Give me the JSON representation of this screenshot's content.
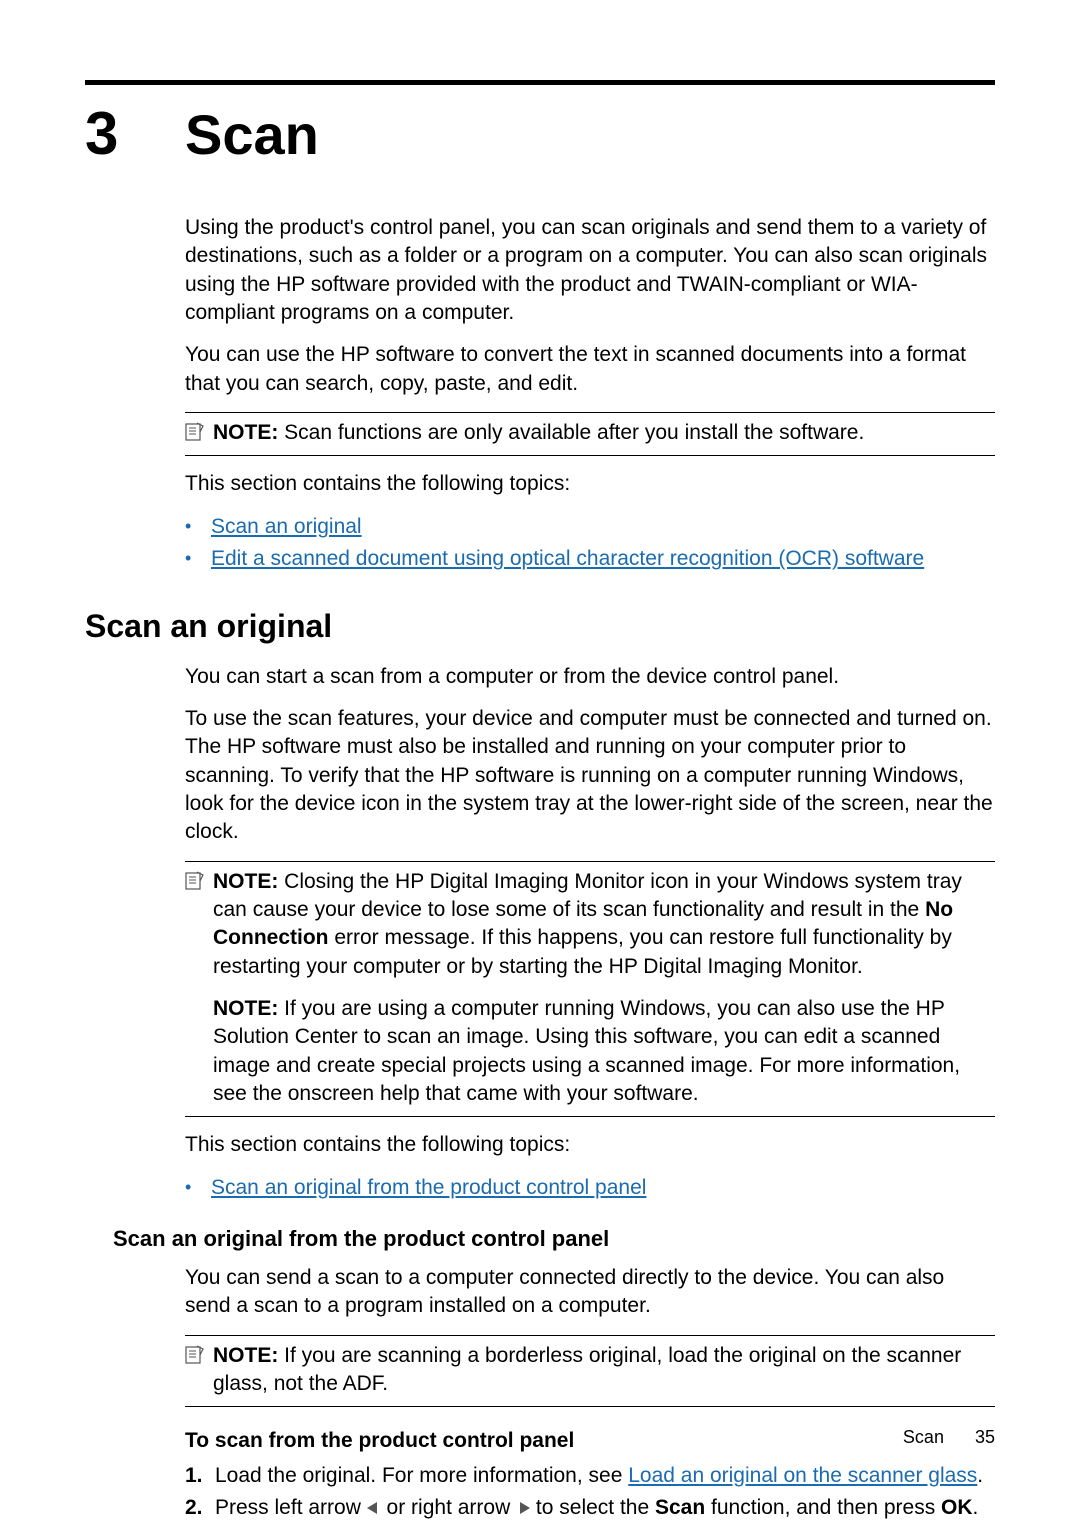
{
  "chapter": {
    "number": "3",
    "title": "Scan"
  },
  "intro_p1": "Using the product's control panel, you can scan originals and send them to a variety of destinations, such as a folder or a program on a computer. You can also scan originals using the HP software provided with the product and TWAIN-compliant or WIA-compliant programs on a computer.",
  "intro_p2": "You can use the HP software to convert the text in scanned documents into a format that you can search, copy, paste, and edit.",
  "note1_label": "NOTE:",
  "note1_text": " Scan functions are only available after you install the software.",
  "topics_lead": "This section contains the following topics:",
  "topics": [
    "Scan an original",
    "Edit a scanned document using optical character recognition (OCR) software"
  ],
  "section1": {
    "heading": "Scan an original",
    "p1": "You can start a scan from a computer or from the device control panel.",
    "p2": "To use the scan features, your device and computer must be connected and turned on. The HP software must also be installed and running on your computer prior to scanning. To verify that the HP software is running on a computer running Windows, look for the device icon in the system tray at the lower-right side of the screen, near the clock.",
    "note2a_label": "NOTE:",
    "note2a_text_before": " Closing the HP Digital Imaging Monitor icon in your Windows system tray can cause your device to lose some of its scan functionality and result in the ",
    "note2a_bold": "No Connection",
    "note2a_text_after": " error message. If this happens, you can restore full functionality by restarting your computer or by starting the HP Digital Imaging Monitor.",
    "note2b_label": "NOTE:",
    "note2b_text": " If you are using a computer running Windows, you can also use the HP Solution Center to scan an image. Using this software, you can edit a scanned image and create special projects using a scanned image. For more information, see the onscreen help that came with your software.",
    "topics_lead": "This section contains the following topics:",
    "topics": [
      "Scan an original from the product control panel"
    ]
  },
  "subsection1": {
    "heading": "Scan an original from the product control panel",
    "p1": "You can send a scan to a computer connected directly to the device. You can also send a scan to a program installed on a computer.",
    "note3_label": "NOTE:",
    "note3_text": " If you are scanning a borderless original, load the original on the scanner glass, not the ADF.",
    "proc_heading": "To scan from the product control panel",
    "step1_before": "Load the original. For more information, see ",
    "step1_link": "Load an original on the scanner glass",
    "step1_after": ".",
    "step2_before": "Press left arrow ",
    "step2_mid1": " or right arrow ",
    "step2_mid2": " to select the ",
    "step2_bold1": "Scan",
    "step2_mid3": " function, and then press ",
    "step2_bold2": "OK",
    "step2_after": "."
  },
  "footer": {
    "label": "Scan",
    "page": "35"
  }
}
